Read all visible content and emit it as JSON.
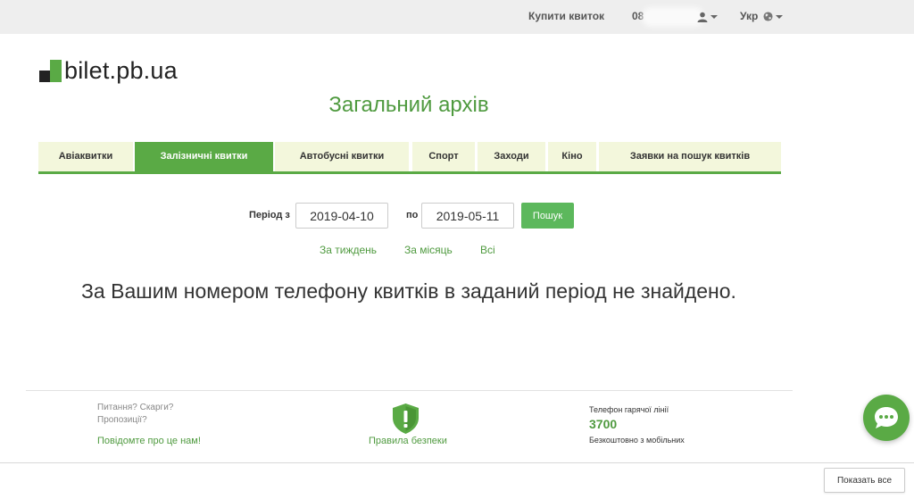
{
  "topbar": {
    "buy_tickets": "Купити квиток",
    "phone_prefix": "08",
    "language": "Укр"
  },
  "logo": {
    "text": "bilet.pb.ua"
  },
  "page_title": "Загальний архів",
  "tabs": [
    {
      "label": "Авіаквитки",
      "active": false
    },
    {
      "label": "Залізничні квитки",
      "active": true
    },
    {
      "label": "Автобусні квитки",
      "active": false
    },
    {
      "label": "Спорт",
      "active": false
    },
    {
      "label": "Заходи",
      "active": false
    },
    {
      "label": "Кіно",
      "active": false
    },
    {
      "label": "Заявки на пошук квитків",
      "active": false
    }
  ],
  "filter": {
    "from_label": "Період з",
    "from_value": "2019-04-10",
    "to_label": "по",
    "to_value": "2019-05-11",
    "search_label": "Пошук"
  },
  "quick_links": {
    "week": "За тиждень",
    "month": "За місяць",
    "all": "Всі"
  },
  "message": "За Вашим номером телефону квитків в заданий період не знайдено.",
  "footer": {
    "questions": "Питання? Скарги?",
    "proposals": "Пропозиції?",
    "report_link": "Повідомте про це нам!",
    "safety_link": "Правила безпеки",
    "hotline_title": "Телефон гарячої лінії",
    "hotline_number": "3700",
    "hotline_note": "Безкоштовно з мобільних"
  },
  "bottom_bar": {
    "show_all": "Показать все"
  },
  "colors": {
    "brand_green": "#5aaa45",
    "link_green": "#4f9a3f",
    "tab_bg": "#f3f7dc"
  }
}
